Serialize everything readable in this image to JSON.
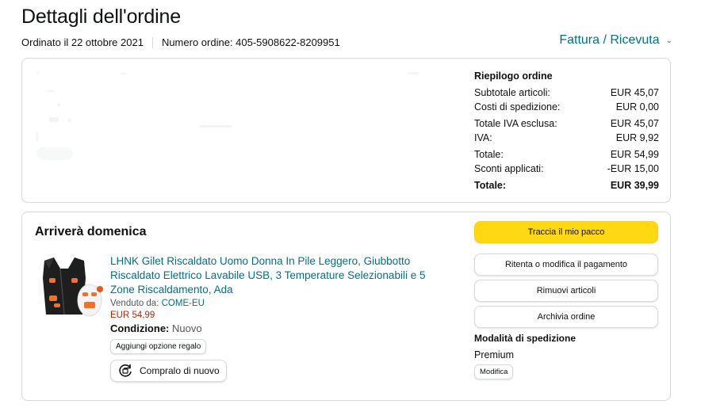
{
  "header": {
    "title": "Dettagli dell'ordine",
    "ordered_on": "Ordinato il 22 ottobre 2021",
    "order_number": "Numero ordine: 405-5908622-8209951",
    "invoice_link": "Fattura / Ricevuta",
    "invoice_icon": "chevron-down-icon"
  },
  "summary": {
    "title": "Riepilogo ordine",
    "rows": [
      {
        "label": "Subtotale articoli:",
        "value": "EUR 45,07"
      },
      {
        "label": "Costi di spedizione:",
        "value": "EUR 0,00"
      },
      {
        "label": "Totale IVA esclusa:",
        "value": "EUR 45,07"
      },
      {
        "label": "IVA:",
        "value": "EUR 9,92"
      },
      {
        "label": "Totale:",
        "value": "EUR 54,99"
      },
      {
        "label": "Sconti applicati:",
        "value": "-EUR 15,00"
      }
    ],
    "grand_total": {
      "label": "Totale:",
      "value": "EUR 39,99"
    }
  },
  "shipment": {
    "arrival": "Arriverà domenica",
    "product": {
      "image_icon": "heated-vest-image",
      "title": "LHNK Gilet Riscaldato Uomo Donna In Pile Leggero, Giubbotto Riscaldato Elettrico Lavabile USB, 3 Temperature Selezionabili e 5 Zone Riscaldamento, Ada",
      "sold_by_label": "Venduto da:",
      "seller": "COME-EU",
      "price": "EUR 54,99",
      "condition_label": "Condizione:",
      "condition_value": "Nuovo",
      "gift_button": "Aggiungi opzione regalo",
      "rebuy_button": "Compralo di nuovo",
      "rebuy_icon": "rebuy-cycle-icon"
    },
    "actions": {
      "track": "Traccia il mio pacco",
      "retry_payment": "Ritenta o modifica il pagamento",
      "remove_items": "Rimuovi articoli",
      "archive": "Archivia ordine"
    },
    "shipping_mode": {
      "label": "Modalità di spedizione",
      "value": "Premium",
      "edit": "Modifica"
    }
  },
  "colors": {
    "link": "#007185",
    "price": "#b12704",
    "primary_button": "#ffd814",
    "border": "#d5d9d9"
  }
}
